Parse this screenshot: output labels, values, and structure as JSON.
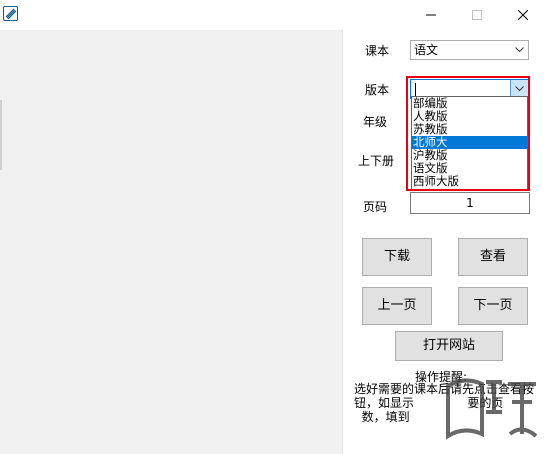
{
  "window": {
    "title": ""
  },
  "form": {
    "textbook": {
      "label": "课本",
      "value": "语文"
    },
    "edition": {
      "label": "版本",
      "value": "",
      "options": [
        "部编版",
        "人教版",
        "苏教版",
        "北师大",
        "沪教版",
        "语文版",
        "西师大版"
      ],
      "highlighted_index": 3
    },
    "grade": {
      "label": "年级"
    },
    "volume": {
      "label": "上下册"
    },
    "page": {
      "label": "页码",
      "value": "1"
    }
  },
  "buttons": {
    "download": "下载",
    "view": "查看",
    "prev": "上一页",
    "next": "下一页",
    "open_site": "打开网站"
  },
  "tips": {
    "title": "操作提醒:",
    "body": "选好需要的课本后请先点击查看按钮，如显示              要的页\n  数，填到"
  },
  "colors": {
    "selection": "#0078d7",
    "annotation": "#e60012",
    "button_face": "#e1e1e1"
  }
}
